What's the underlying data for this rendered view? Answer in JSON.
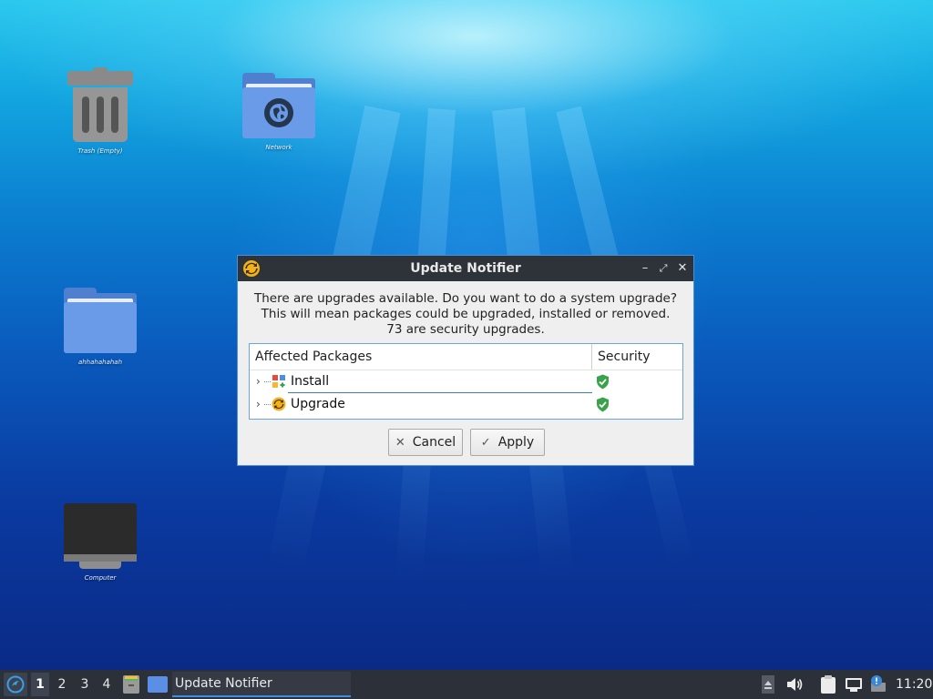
{
  "desktop": {
    "icons": [
      {
        "label": "Trash (Empty)"
      },
      {
        "label": "Network"
      },
      {
        "label": "ahhahahahah"
      },
      {
        "label": "Computer"
      }
    ]
  },
  "dialog": {
    "title": "Update Notifier",
    "message_lines": [
      "There are upgrades available. Do you want to do a system upgrade?",
      "This will mean packages could be upgraded, installed or removed.",
      "73 are security upgrades."
    ],
    "table": {
      "columns": [
        "Affected Packages",
        "Security"
      ],
      "rows": [
        {
          "label": "Install",
          "icon": "install-package-icon",
          "security_icon": "shield-check-icon"
        },
        {
          "label": "Upgrade",
          "icon": "upgrade-package-icon",
          "security_icon": "shield-check-icon"
        }
      ]
    },
    "buttons": {
      "cancel": "Cancel",
      "apply": "Apply"
    },
    "window_controls": [
      "minimize",
      "maximize",
      "close"
    ]
  },
  "taskbar": {
    "desktops": [
      "1",
      "2",
      "3",
      "4"
    ],
    "active_desktop": "1",
    "task_label": "Update Notifier",
    "clock": "11:20"
  },
  "colors": {
    "titlebar": "#2e3239",
    "accent": "#3d8ee3",
    "shield_green": "#3aa24a",
    "taskbar": "#2c3038"
  }
}
